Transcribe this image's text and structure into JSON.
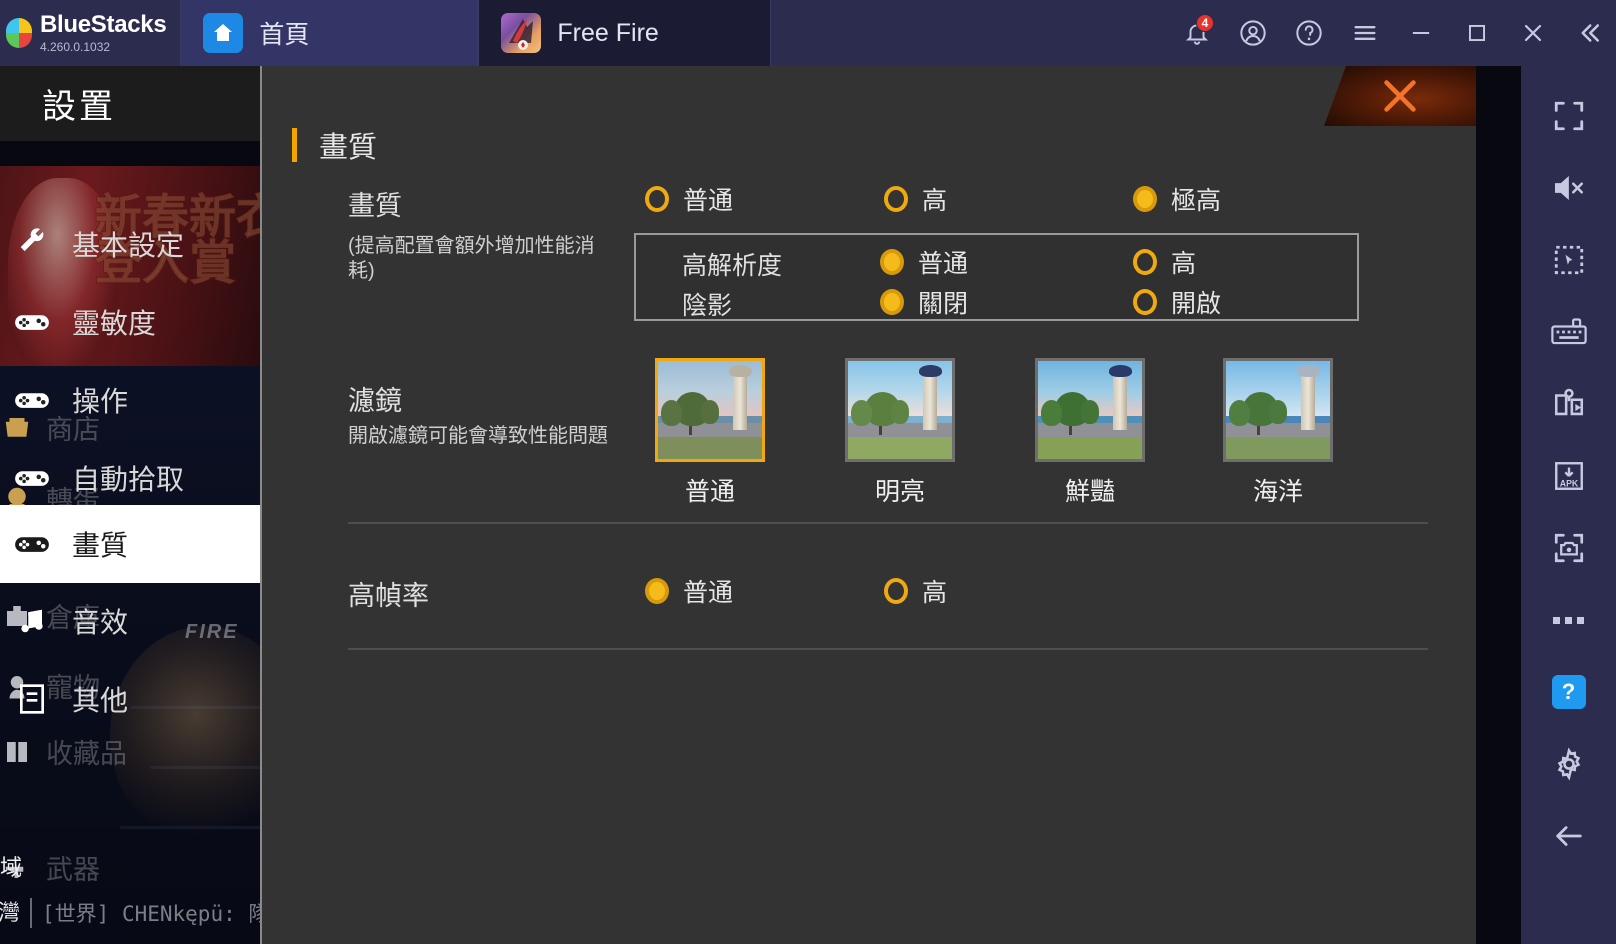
{
  "titlebar": {
    "brand_name": "BlueStacks",
    "brand_version": "4.260.0.1032",
    "tabs": [
      {
        "label": "首頁",
        "icon": "home-icon"
      },
      {
        "label": "Free Fire",
        "icon": "free-fire-app-icon"
      }
    ],
    "notification_count": "4",
    "icons": [
      "notification-bell-icon",
      "user-account-icon",
      "help-circle-icon",
      "hamburger-menu-icon",
      "minimize-icon",
      "maximize-icon",
      "close-icon",
      "collapse-chevrons-icon"
    ]
  },
  "right_toolbar": {
    "items": [
      "fullscreen-icon",
      "mute-volume-icon",
      "select-region-icon",
      "keyboard-controls-icon",
      "macro-recorder-icon",
      "install-apk-icon",
      "screenshot-icon",
      "more-options-icon",
      "help-button-icon",
      "settings-gear-icon",
      "back-arrow-icon"
    ],
    "help_label": "?"
  },
  "game_background": {
    "banner_text_line1": "新春新衣",
    "banner_text_line2": "登入賞",
    "fire_tag": "FIRE",
    "menu_items": [
      {
        "label": "商店",
        "icon": "shop-icon"
      },
      {
        "label": "轉蛋",
        "icon": "gacha-icon"
      },
      {
        "label": "倉庫",
        "icon": "inventory-icon"
      },
      {
        "label": "寵物",
        "icon": "pet-icon"
      },
      {
        "label": "收藏品",
        "icon": "collection-icon"
      },
      {
        "label": "武器",
        "icon": "weapon-icon"
      }
    ],
    "region_top": "域",
    "region_bottom": "灣",
    "chat_message": "[世界] CHENkępü: 隊伍"
  },
  "settings": {
    "title": "設置",
    "sidebar_items": [
      {
        "label": "基本設定",
        "icon": "wrench-icon",
        "selected": false
      },
      {
        "label": "靈敏度",
        "icon": "gamepad-icon",
        "selected": false
      },
      {
        "label": "操作",
        "icon": "gamepad-icon",
        "selected": false
      },
      {
        "label": "自動拾取",
        "icon": "gamepad-icon",
        "selected": false
      },
      {
        "label": "畫質",
        "icon": "gamepad-icon",
        "selected": true
      },
      {
        "label": "音效",
        "icon": "music-note-icon",
        "selected": false
      },
      {
        "label": "其他",
        "icon": "document-icon",
        "selected": false
      }
    ],
    "panel": {
      "heading": "畫質",
      "close_label": "×",
      "quality": {
        "label": "畫質",
        "note": "(提高配置會額外增加性能消耗)",
        "options": [
          {
            "label": "普通",
            "selected": false
          },
          {
            "label": "高",
            "selected": false
          },
          {
            "label": "極高",
            "selected": true
          }
        ],
        "sub_rows": [
          {
            "label": "高解析度",
            "options": [
              {
                "label": "普通",
                "selected": true
              },
              {
                "label": "高",
                "selected": false
              }
            ]
          },
          {
            "label": "陰影",
            "options": [
              {
                "label": "關閉",
                "selected": true
              },
              {
                "label": "開啟",
                "selected": false
              }
            ]
          }
        ]
      },
      "filter": {
        "label": "濾鏡",
        "note": "開啟濾鏡可能會導致性能問題",
        "items": [
          {
            "label": "普通",
            "selected": true,
            "sky": "#9dbcd6",
            "sky2": "#e8c4c0",
            "grass": "#7f8f5c",
            "tree": "#4f6b3a",
            "sea": "#6b8fa8",
            "towertop": "#b8b0a0"
          },
          {
            "label": "明亮",
            "selected": false,
            "sky": "#87c4e8",
            "sky2": "#f2ded8",
            "grass": "#8fa862",
            "tree": "#5a8040",
            "sea": "#7fb0cf",
            "towertop": "#c8c0b0"
          },
          {
            "label": "鮮豔",
            "selected": false,
            "sky": "#6fb4e0",
            "sky2": "#f0c8c0",
            "grass": "#86a055",
            "tree": "#3f7033",
            "sea": "#4f90bb",
            "towertop": "#2a3a6a"
          },
          {
            "label": "海洋",
            "selected": false,
            "sky": "#77b8e6",
            "sky2": "#d8e8f2",
            "grass": "#7f9a5c",
            "tree": "#47753a",
            "sea": "#4a86b8",
            "towertop": "#aab4c0"
          }
        ]
      },
      "framerate": {
        "label": "高幀率",
        "options": [
          {
            "label": "普通",
            "selected": true
          },
          {
            "label": "高",
            "selected": false
          }
        ]
      }
    }
  },
  "colors": {
    "accent_yellow": "#f0a500",
    "titlebar_bg": "#2b2c4e",
    "panel_bg": "#333333",
    "badge_red": "#e8322a",
    "help_blue": "#1e9bf0"
  }
}
